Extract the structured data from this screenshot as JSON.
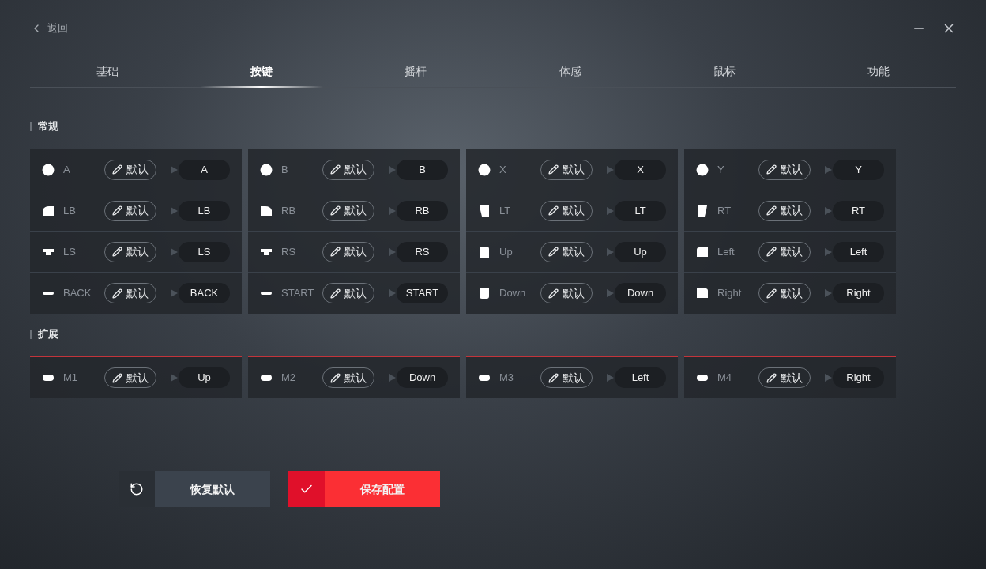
{
  "header": {
    "back": "返回"
  },
  "tabs": [
    {
      "label": "基础",
      "selected": false
    },
    {
      "label": "按键",
      "selected": true
    },
    {
      "label": "摇杆",
      "selected": false
    },
    {
      "label": "体感",
      "selected": false
    },
    {
      "label": "鼠标",
      "selected": false
    },
    {
      "label": "功能",
      "selected": false
    }
  ],
  "sections": [
    {
      "title": "常规",
      "cards": [
        [
          {
            "kind": "circle",
            "name": "A",
            "edit": "默认",
            "target": "A"
          },
          {
            "kind": "bumper-left",
            "name": "LB",
            "edit": "默认",
            "target": "LB"
          },
          {
            "kind": "stick",
            "name": "LS",
            "edit": "默认",
            "target": "LS"
          },
          {
            "kind": "bar",
            "name": "BACK",
            "edit": "默认",
            "target": "BACK"
          }
        ],
        [
          {
            "kind": "circle",
            "name": "B",
            "edit": "默认",
            "target": "B"
          },
          {
            "kind": "bumper-right",
            "name": "RB",
            "edit": "默认",
            "target": "RB"
          },
          {
            "kind": "stick",
            "name": "RS",
            "edit": "默认",
            "target": "RS"
          },
          {
            "kind": "bar",
            "name": "START",
            "edit": "默认",
            "target": "START"
          }
        ],
        [
          {
            "kind": "circle",
            "name": "X",
            "edit": "默认",
            "target": "X"
          },
          {
            "kind": "trigger-left",
            "name": "LT",
            "edit": "默认",
            "target": "LT"
          },
          {
            "kind": "dpad-up",
            "name": "Up",
            "edit": "默认",
            "target": "Up"
          },
          {
            "kind": "dpad-down",
            "name": "Down",
            "edit": "默认",
            "target": "Down"
          }
        ],
        [
          {
            "kind": "circle",
            "name": "Y",
            "edit": "默认",
            "target": "Y"
          },
          {
            "kind": "trigger-right",
            "name": "RT",
            "edit": "默认",
            "target": "RT"
          },
          {
            "kind": "dpad-left",
            "name": "Left",
            "edit": "默认",
            "target": "Left"
          },
          {
            "kind": "dpad-right",
            "name": "Right",
            "edit": "默认",
            "target": "Right"
          }
        ]
      ]
    },
    {
      "title": "扩展",
      "cards": [
        [
          {
            "kind": "pill",
            "name": "M1",
            "edit": "默认",
            "target": "Up"
          }
        ],
        [
          {
            "kind": "pill",
            "name": "M2",
            "edit": "默认",
            "target": "Down"
          }
        ],
        [
          {
            "kind": "pill",
            "name": "M3",
            "edit": "默认",
            "target": "Left"
          }
        ],
        [
          {
            "kind": "pill",
            "name": "M4",
            "edit": "默认",
            "target": "Right"
          }
        ]
      ]
    }
  ],
  "actions": [
    {
      "kind": "reset",
      "label": "恢复默认"
    },
    {
      "kind": "save",
      "label": "保存配置"
    }
  ]
}
